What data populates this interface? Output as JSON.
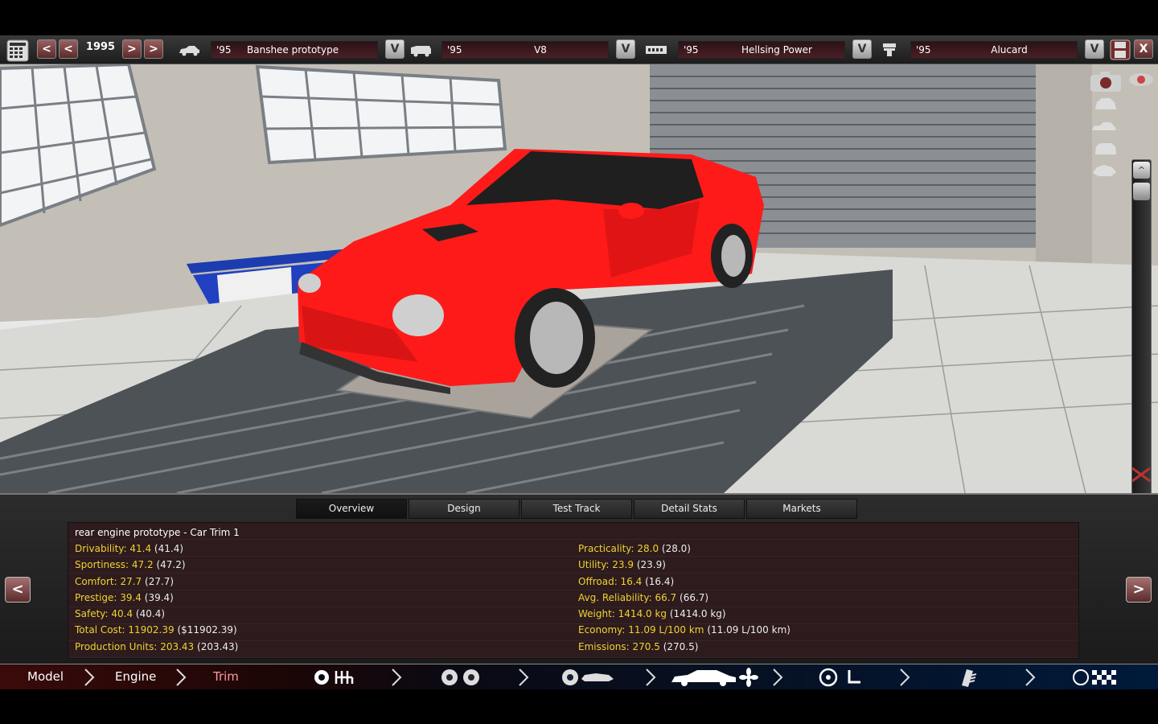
{
  "toolbar": {
    "year": "1995",
    "selectors": [
      {
        "year": "'95",
        "name": "Banshee prototype"
      },
      {
        "year": "'95",
        "name": "V8"
      },
      {
        "year": "'95",
        "name": "Hellsing Power"
      },
      {
        "year": "'95",
        "name": "Alucard"
      }
    ],
    "arrow_prev": "<",
    "arrow_next": ">",
    "dropdown": "V",
    "close": "X"
  },
  "scroll": {
    "up": "^",
    "down": "v"
  },
  "tabs": [
    "Overview",
    "Design",
    "Test Track",
    "Detail Stats",
    "Markets"
  ],
  "active_tab": "Overview",
  "panel_arrows": {
    "left": "<",
    "right": ">"
  },
  "overview": {
    "title": "rear engine prototype - Car Trim 1",
    "left_stats": [
      {
        "label": "Drivability: 41.4",
        "value": "(41.4)"
      },
      {
        "label": "Sportiness: 47.2",
        "value": "(47.2)"
      },
      {
        "label": "Comfort: 27.7",
        "value": "(27.7)"
      },
      {
        "label": "Prestige: 39.4",
        "value": "(39.4)"
      },
      {
        "label": "Safety: 40.4",
        "value": "(40.4)"
      },
      {
        "label": "Total Cost: 11902.39",
        "value": "($11902.39)"
      },
      {
        "label": "Production Units: 203.43",
        "value": "(203.43)"
      }
    ],
    "right_stats": [
      {
        "label": "Practicality: 28.0",
        "value": "(28.0)"
      },
      {
        "label": "Utility: 23.9",
        "value": "(23.9)"
      },
      {
        "label": "Offroad: 16.4",
        "value": "(16.4)"
      },
      {
        "label": "Avg. Reliability: 66.7",
        "value": "(66.7)"
      },
      {
        "label": "Weight: 1414.0 kg",
        "value": "(1414.0 kg)"
      },
      {
        "label": "Economy: 11.09 L/100 km",
        "value": "(11.09 L/100 km)"
      },
      {
        "label": "Emissions: 270.5",
        "value": "(270.5)"
      }
    ]
  },
  "nav": {
    "model": "Model",
    "engine": "Engine",
    "trim": "Trim"
  },
  "colors": {
    "car": "#ff1a1a",
    "stat_label": "#f0d233",
    "accent_red": "#7a2a2a"
  }
}
